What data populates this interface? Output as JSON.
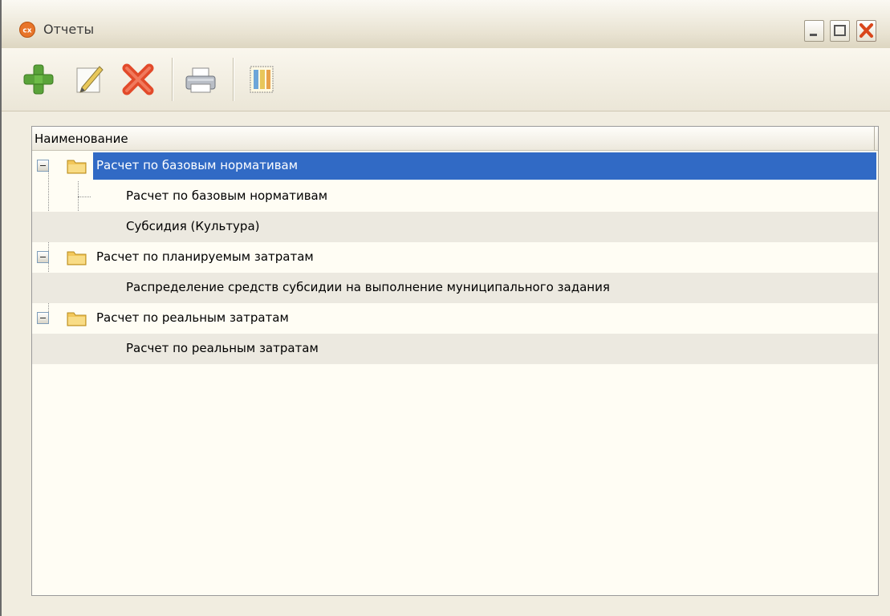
{
  "window": {
    "title": "Отчеты",
    "controls": [
      "minimize",
      "maximize",
      "close"
    ]
  },
  "toolbar": {
    "buttons": [
      {
        "icon": "plus-icon",
        "tooltip": ""
      },
      {
        "icon": "edit-pencil-icon",
        "tooltip": ""
      },
      {
        "icon": "delete-x-icon",
        "tooltip": ""
      },
      {
        "icon": "print-icon",
        "tooltip": ""
      },
      {
        "icon": "column-settings-icon",
        "tooltip": ""
      }
    ]
  },
  "tree": {
    "column_header": "Наименование",
    "groups": [
      {
        "label": "Расчет по базовым нормативам",
        "expanded": true,
        "selected": true,
        "children": [
          "Расчет по базовым нормативам",
          "Субсидия (Культура)"
        ]
      },
      {
        "label": "Расчет по планируемым затратам",
        "expanded": true,
        "selected": false,
        "children": [
          "Распределение средств субсидии на выполнение муниципального задания"
        ]
      },
      {
        "label": "Расчет по реальным затратам",
        "expanded": true,
        "selected": false,
        "children": [
          "Расчет по реальным затратам"
        ]
      }
    ]
  },
  "colors": {
    "selection": "#316ac5",
    "close_button": "#d9461b",
    "plus": "#5aa33a",
    "delete": "#e24a2a",
    "folder": "#f2c75a"
  }
}
